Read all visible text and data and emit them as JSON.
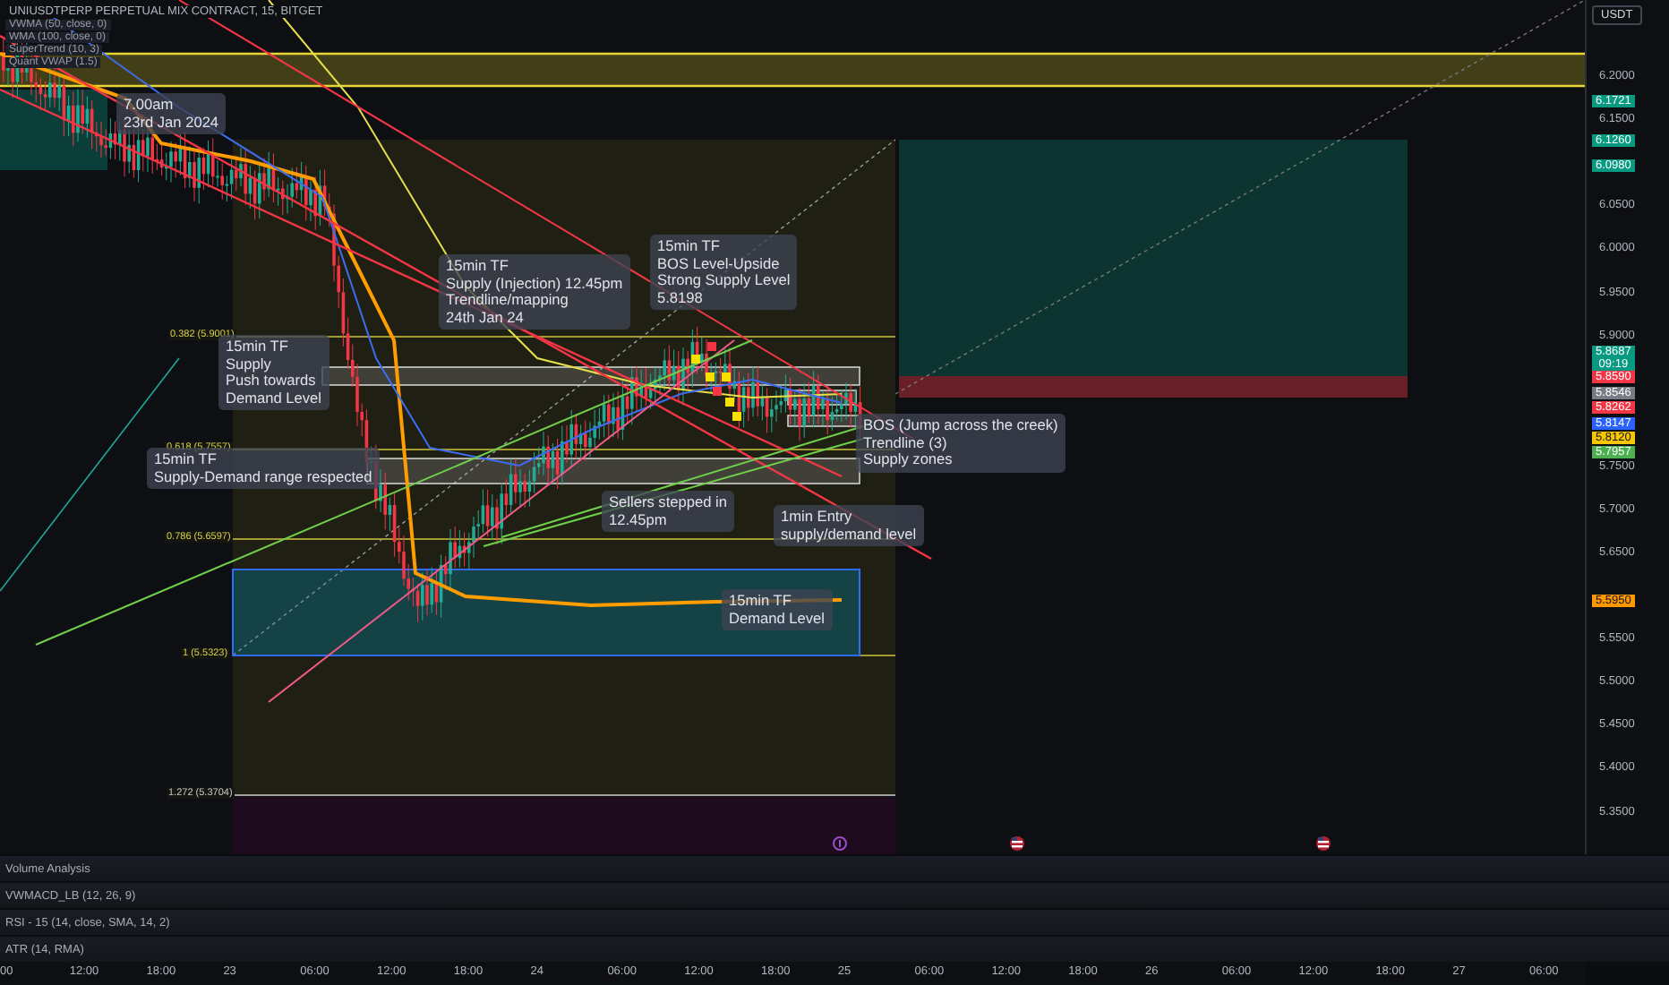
{
  "legend": {
    "symbol": "UNIUSDTPERP PERPETUAL MIX CONTRACT, 15, BITGET",
    "indicators": [
      "VWMA (50, close, 0)",
      "WMA (100, close, 0)",
      "SuperTrend (10, 3)",
      "Quant VWAP (1.5)"
    ]
  },
  "annotations": [
    {
      "text": "7.00am\n23rd Jan 2024"
    },
    {
      "text": "15min TF\nSupply (Injection) 12.45pm\nTrendline/mapping\n24th Jan 24"
    },
    {
      "text": "15min TF\nBOS Level-Upside\nStrong Supply Level\n5.8198"
    },
    {
      "text": "15min TF\nSupply\nPush towards\nDemand Level"
    },
    {
      "text": "15min TF\nSupply-Demand range respected"
    },
    {
      "text": "BOS (Jump across the creek)\nTrendline (3)\nSupply zones"
    },
    {
      "text": "Sellers stepped in\n12.45pm"
    },
    {
      "text": "1min Entry\nsupply/demand level"
    },
    {
      "text": "15min TF\nDemand Level"
    }
  ],
  "fib_levels": [
    "0.382 (5.9001)",
    "0.618 (5.7557)",
    "0.786 (5.6597)",
    "1 (5.5323)",
    "1.272 (5.3704)"
  ],
  "price_axis": {
    "currency": "USDT",
    "ticks": [
      "6.2000",
      "6.1500",
      "6.0500",
      "6.0000",
      "5.9500",
      "5.9000",
      "5.7500",
      "5.7000",
      "5.6500",
      "5.5500",
      "5.5000",
      "5.4500",
      "5.4000",
      "5.3500"
    ],
    "badges": [
      {
        "label": "6.1721",
        "color": "#089981"
      },
      {
        "label": "6.1260",
        "color": "#089981"
      },
      {
        "label": "6.0980",
        "color": "#089981"
      },
      {
        "label": "5.8687",
        "countdown": "09:19",
        "color": "#089981"
      },
      {
        "label": "5.8590",
        "color": "#f23645"
      },
      {
        "label": "5.8546",
        "color": "#787b86"
      },
      {
        "label": "5.8262",
        "color": "#f23645"
      },
      {
        "label": "5.8147",
        "color": "#2962ff"
      },
      {
        "label": "5.8120",
        "color": "#f7c600"
      },
      {
        "label": "5.7957",
        "color": "#4caf50"
      },
      {
        "label": "5.5950",
        "color": "#ff9800"
      }
    ]
  },
  "panes": [
    "Volume Analysis",
    "VWMACD_LB (12, 26, 9)",
    "RSI - 15 (14, close, SMA, 14, 2)",
    "ATR (14, RMA)"
  ],
  "time_axis": [
    "00",
    "12:00",
    "18:00",
    "23",
    "06:00",
    "12:00",
    "18:00",
    "24",
    "06:00",
    "12:00",
    "18:00",
    "25",
    "06:00",
    "12:00",
    "18:00",
    "26",
    "06:00",
    "12:00",
    "18:00",
    "27",
    "06:00"
  ]
}
